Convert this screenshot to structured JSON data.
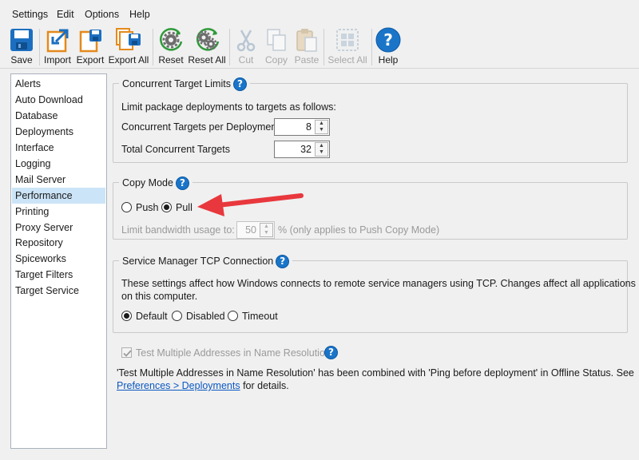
{
  "menu": [
    "Settings",
    "Edit",
    "Options",
    "Help"
  ],
  "toolbar": {
    "save": "Save",
    "import": "Import",
    "export": "Export",
    "export_all": "Export All",
    "reset": "Reset",
    "reset_all": "Reset All",
    "cut": "Cut",
    "copy": "Copy",
    "paste": "Paste",
    "select_all": "Select All",
    "help": "Help"
  },
  "sidebar": {
    "items": [
      "Alerts",
      "Auto Download",
      "Database",
      "Deployments",
      "Interface",
      "Logging",
      "Mail Server",
      "Performance",
      "Printing",
      "Proxy Server",
      "Repository",
      "Spiceworks",
      "Target Filters",
      "Target Service"
    ],
    "selected": "Performance"
  },
  "concurrent": {
    "title": "Concurrent Target Limits",
    "intro": "Limit package deployments to targets as follows:",
    "per_deployment_label": "Concurrent Targets per Deployment",
    "per_deployment_value": "8",
    "total_label": "Total Concurrent Targets",
    "total_value": "32"
  },
  "copy_mode": {
    "title": "Copy Mode",
    "push_label": "Push",
    "pull_label": "Pull",
    "selected": "Pull",
    "bandwidth_label": "Limit bandwidth usage to:",
    "bandwidth_value": "50",
    "bandwidth_suffix": "% (only applies to Push Copy Mode)"
  },
  "tcp": {
    "title": "Service Manager TCP Connection",
    "desc_line1": "These settings affect how Windows connects to remote service managers using TCP. Changes affect all applications",
    "desc_line2": "on this computer.",
    "options": [
      "Default",
      "Disabled",
      "Timeout"
    ],
    "selected": "Default"
  },
  "multi_address": {
    "label": "Test Multiple Addresses in Name Resolution",
    "checked": true,
    "note_line1": "'Test Multiple Addresses in Name Resolution' has been combined with 'Ping before deployment' in Offline Status. See",
    "link": "Preferences > Deployments",
    "note_tail": " for details."
  },
  "colors": {
    "accent_blue": "#1a75c9",
    "selection": "#cce4f7",
    "arrow_red": "#e8383d",
    "link": "#0b58c2"
  }
}
